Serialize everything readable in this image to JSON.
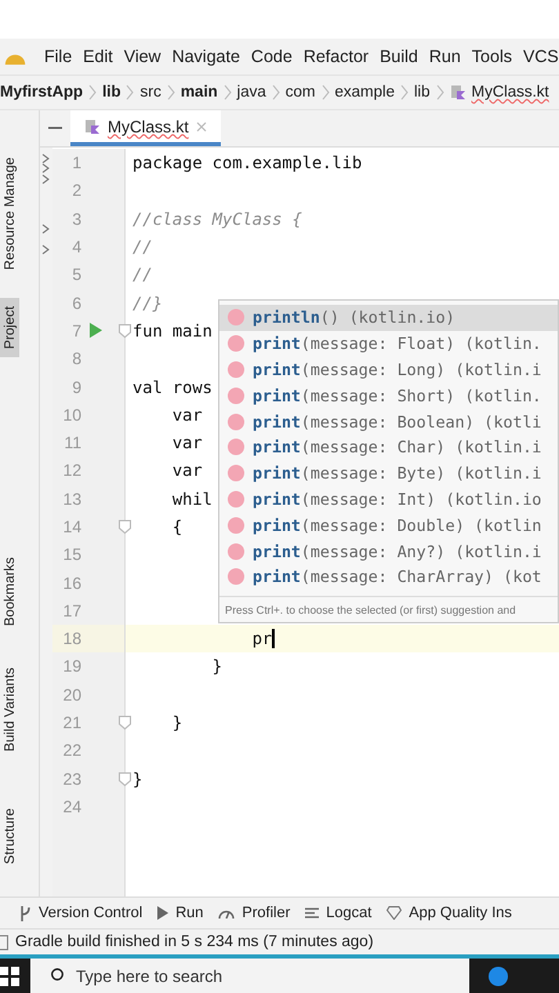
{
  "menu": [
    "File",
    "Edit",
    "View",
    "Navigate",
    "Code",
    "Refactor",
    "Build",
    "Run",
    "Tools",
    "VCS"
  ],
  "breadcrumbs": [
    {
      "label": "MyfirstApp",
      "bold": true
    },
    {
      "label": "lib",
      "bold": true
    },
    {
      "label": "src",
      "bold": false
    },
    {
      "label": "main",
      "bold": true
    },
    {
      "label": "java",
      "bold": false
    },
    {
      "label": "com",
      "bold": false
    },
    {
      "label": "example",
      "bold": false
    },
    {
      "label": "lib",
      "bold": false
    },
    {
      "label": "MyClass.kt",
      "bold": false,
      "kind": "file"
    }
  ],
  "tabs": [
    {
      "label": "MyClass.kt",
      "selected": true
    }
  ],
  "tool_windows": [
    {
      "label": "Resource Manage",
      "selected": false
    },
    {
      "label": "Project",
      "selected": true
    },
    {
      "label": "Bookmarks",
      "selected": false
    },
    {
      "label": "Build Variants",
      "selected": false
    },
    {
      "label": "Structure",
      "selected": false
    }
  ],
  "editor": {
    "lines": [
      {
        "number": "1",
        "text": "package com.example.lib",
        "kind": "code"
      },
      {
        "number": "2"
      },
      {
        "number": "3",
        "text": "//class MyClass {",
        "kind": "comment"
      },
      {
        "number": "4",
        "text": "//",
        "kind": "comment"
      },
      {
        "number": "5",
        "text": "//",
        "kind": "comment"
      },
      {
        "number": "6",
        "text": "//}",
        "kind": "comment"
      },
      {
        "number": "7",
        "text": "fun main",
        "kind": "code",
        "runnable": true,
        "foldable": true
      },
      {
        "number": "8"
      },
      {
        "number": "9",
        "text": "val rows",
        "kind": "code"
      },
      {
        "number": "10",
        "text": "    var",
        "kind": "code"
      },
      {
        "number": "11",
        "text": "    var",
        "kind": "code"
      },
      {
        "number": "12",
        "text": "    var",
        "kind": "code"
      },
      {
        "number": "13",
        "text": "    whil",
        "kind": "code"
      },
      {
        "number": "14",
        "text": "    {",
        "kind": "code",
        "foldable": true
      },
      {
        "number": "15"
      },
      {
        "number": "16"
      },
      {
        "number": "17"
      },
      {
        "number": "18",
        "text": "            pr",
        "kind": "code",
        "current": true
      },
      {
        "number": "19",
        "text": "        }",
        "kind": "code"
      },
      {
        "number": "20"
      },
      {
        "number": "21",
        "text": "    }",
        "kind": "code",
        "foldable": true
      },
      {
        "number": "22"
      },
      {
        "number": "23",
        "text": "}",
        "kind": "code",
        "foldable": true
      },
      {
        "number": "24"
      }
    ]
  },
  "completion": {
    "items": [
      {
        "name": "println",
        "signature": "() (kotlin.io)",
        "selected": true
      },
      {
        "name": "print",
        "signature": "(message: Float) (kotlin.",
        "selected": false
      },
      {
        "name": "print",
        "signature": "(message: Long) (kotlin.i",
        "selected": false
      },
      {
        "name": "print",
        "signature": "(message: Short) (kotlin.",
        "selected": false
      },
      {
        "name": "print",
        "signature": "(message: Boolean) (kotli",
        "selected": false
      },
      {
        "name": "print",
        "signature": "(message: Char) (kotlin.i",
        "selected": false
      },
      {
        "name": "print",
        "signature": "(message: Byte) (kotlin.i",
        "selected": false
      },
      {
        "name": "print",
        "signature": "(message: Int) (kotlin.io",
        "selected": false
      },
      {
        "name": "print",
        "signature": "(message: Double) (kotlin",
        "selected": false
      },
      {
        "name": "print",
        "signature": "(message: Any?) (kotlin.i",
        "selected": false
      },
      {
        "name": "print",
        "signature": "(message: CharArray) (kot",
        "selected": false
      }
    ],
    "hint": "Press Ctrl+. to choose the selected (or first) suggestion and"
  },
  "tool_bar": [
    "Version Control",
    "Run",
    "Profiler",
    "Logcat",
    "App Quality Ins"
  ],
  "status_bar": "Gradle build finished in 5 s 234 ms (7 minutes ago)",
  "taskbar": {
    "search_placeholder": "Type here to search"
  }
}
